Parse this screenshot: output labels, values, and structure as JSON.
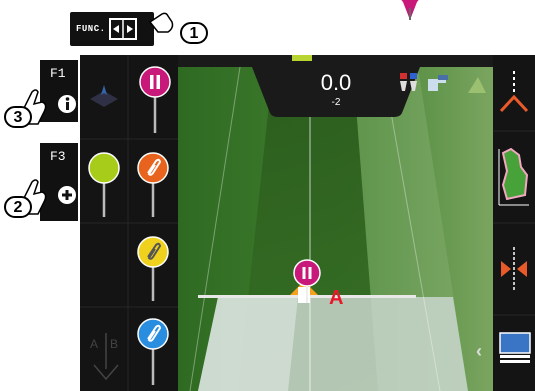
{
  "function_key": {
    "label": "FUNC.",
    "callout": "1"
  },
  "f1_key": {
    "label": "F1",
    "callout": "3"
  },
  "f3_key": {
    "label": "F3",
    "callout": "2"
  },
  "guidance": {
    "speed_value": "0.0",
    "offset_value": "-2",
    "point_label": "A"
  },
  "left_panel": {
    "ab_label_a": "A",
    "ab_label_b": "B"
  },
  "colors": {
    "magenta_pin": "#c8197a",
    "green_pin": "#a8cc1a",
    "orange_pin": "#e8641e",
    "yellow_pin": "#f0d21e",
    "blue_pin": "#2a8ee0",
    "marker_red": "#e8192c",
    "tractor_orange": "#f5a01e"
  },
  "icons": [
    "pause-pin-icon",
    "clip-pin-icon",
    "plain-pin-icon",
    "gps-icon",
    "ab-line-icon",
    "field-boundary-icon",
    "split-arrows-icon",
    "screen-icon",
    "chevron-left-icon",
    "info-icon",
    "plus-icon",
    "hand-pointer-icon"
  ]
}
